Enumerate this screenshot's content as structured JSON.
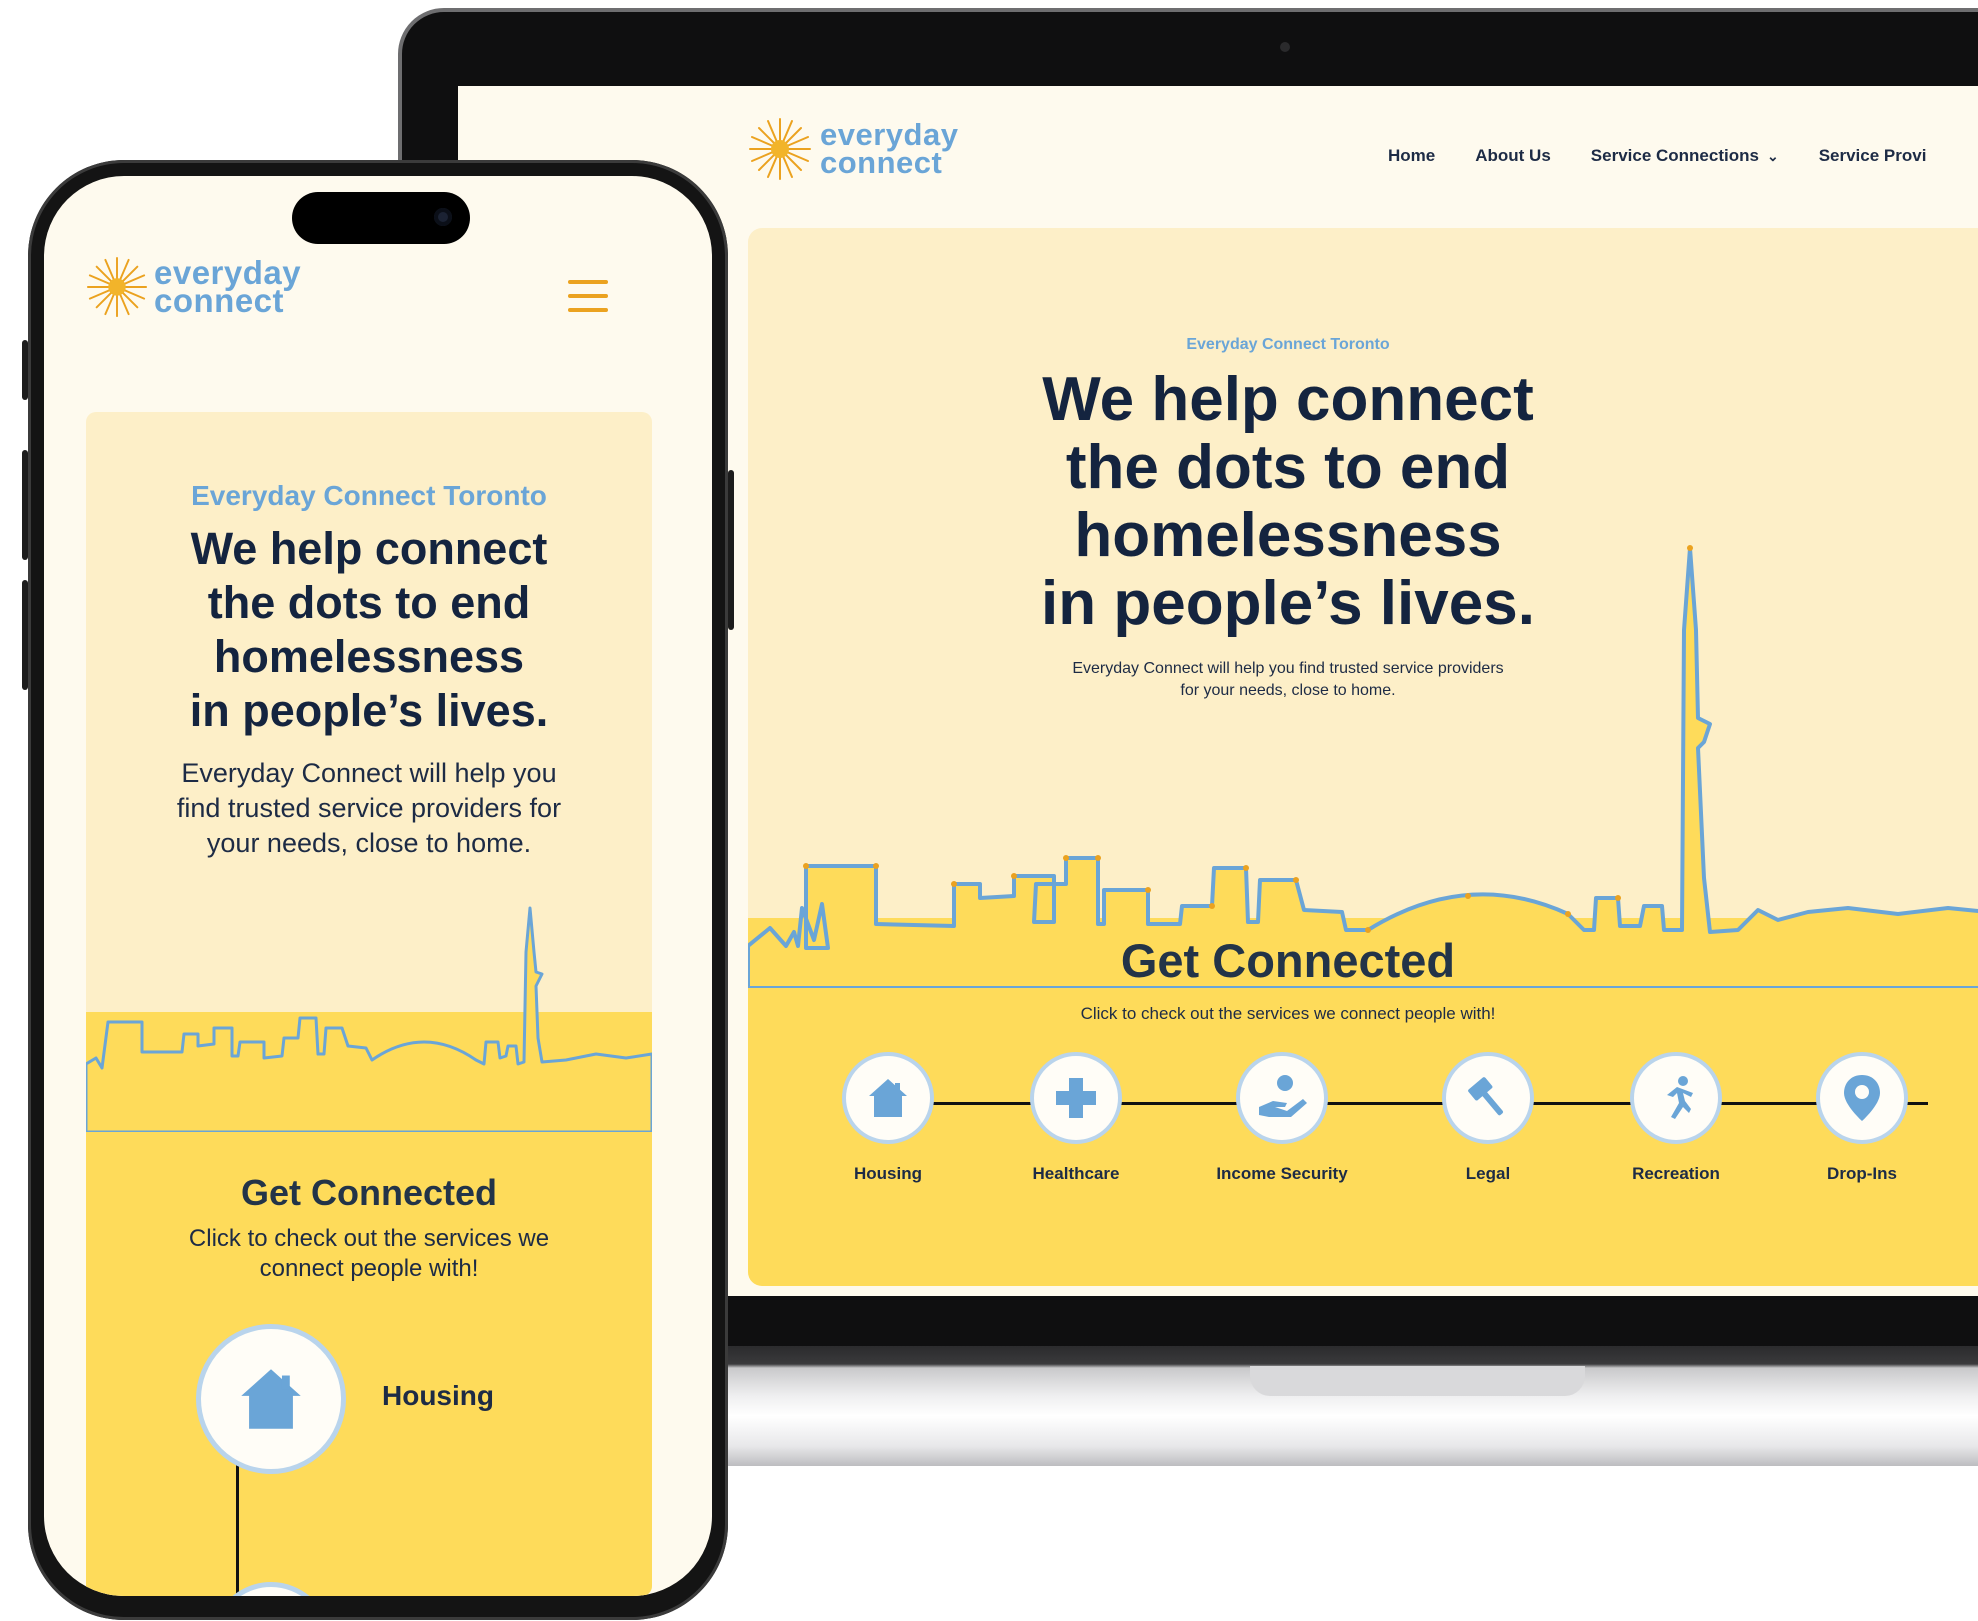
{
  "brand": {
    "logo_line1": "everyday",
    "logo_line2": "connect",
    "colors": {
      "accent_blue": "#6aa5d7",
      "navy": "#14243f",
      "cream": "#fefaee",
      "hero_bg": "#fdefc8",
      "yellow": "#fedb5a",
      "menu_orange": "#eba21f"
    }
  },
  "desktop": {
    "nav": {
      "items": [
        {
          "label": "Home"
        },
        {
          "label": "About Us"
        },
        {
          "label": "Service Connections",
          "icon": "chevron-down-icon"
        },
        {
          "label": "Service Provi"
        }
      ]
    },
    "hero": {
      "kicker": "Everyday Connect Toronto",
      "title_lines": [
        "We help connect",
        "the dots to end",
        "homelessness",
        "in people’s lives."
      ],
      "subtitle_lines": [
        "Everyday Connect will help you find trusted service providers",
        "for your needs, close to home."
      ]
    },
    "get_connected": {
      "title": "Get Connected",
      "subtitle": "Click to check out the services we connect people with!",
      "services": [
        {
          "label": "Housing",
          "icon": "house-icon"
        },
        {
          "label": "Healthcare",
          "icon": "plus-icon"
        },
        {
          "label": "Income Security",
          "icon": "hand-coin-icon"
        },
        {
          "label": "Legal",
          "icon": "gavel-icon"
        },
        {
          "label": "Recreation",
          "icon": "running-person-icon"
        },
        {
          "label": "Drop-Ins",
          "icon": "map-pin-icon"
        }
      ]
    }
  },
  "mobile": {
    "menu_icon": "hamburger-menu-icon",
    "hero": {
      "kicker": "Everyday Connect Toronto",
      "title_lines": [
        "We help connect",
        "the dots to end",
        "homelessness",
        "in people’s lives."
      ],
      "subtitle_lines": [
        "Everyday Connect will help you",
        "find trusted service providers for",
        "your needs, close to home."
      ]
    },
    "get_connected": {
      "title": "Get Connected",
      "subtitle_lines": [
        "Click to check out the services we",
        "connect people with!"
      ],
      "services": [
        {
          "label": "Housing",
          "icon": "house-icon"
        }
      ]
    }
  }
}
